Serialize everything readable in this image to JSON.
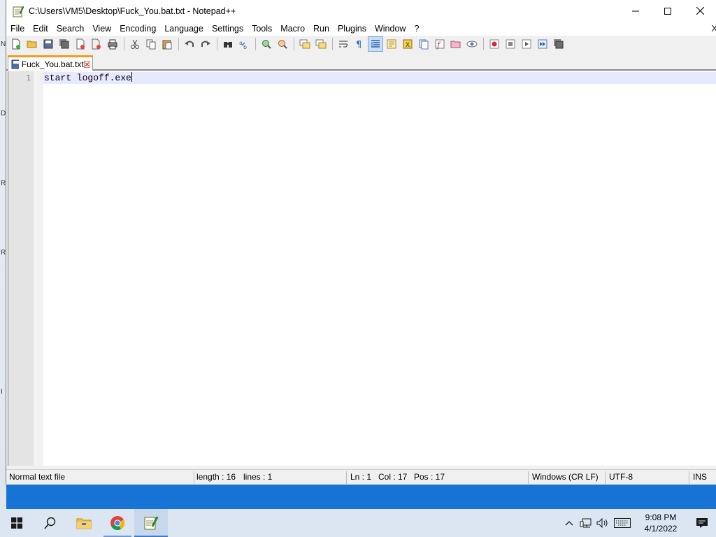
{
  "window": {
    "title": "C:\\Users\\VM5\\Desktop\\Fuck_You.bat.txt - Notepad++"
  },
  "menu": {
    "items": [
      "File",
      "Edit",
      "Search",
      "View",
      "Encoding",
      "Language",
      "Settings",
      "Tools",
      "Macro",
      "Run",
      "Plugins",
      "Window",
      "?"
    ],
    "close_glyph": "X"
  },
  "tab": {
    "label": "Fuck_You.bat.txt"
  },
  "editor": {
    "line_number": "1",
    "line_text": "start logoff.exe"
  },
  "status": {
    "file_type": "Normal text file",
    "length": "length : 16",
    "lines": "lines : 1",
    "ln": "Ln : 1",
    "col": "Col : 17",
    "pos": "Pos : 17",
    "eol": "Windows (CR LF)",
    "encoding": "UTF-8",
    "mode": "INS"
  },
  "taskbar": {
    "time": "9:08 PM",
    "date": "4/1/2022"
  },
  "desktop": {
    "edge_letters": [
      "N",
      "D",
      "R",
      "R",
      "I"
    ]
  },
  "colors": {
    "tab_accent": "#fa9a1a",
    "current_line": "#e8e8ff",
    "desktop_blue": "#0d63c4"
  }
}
